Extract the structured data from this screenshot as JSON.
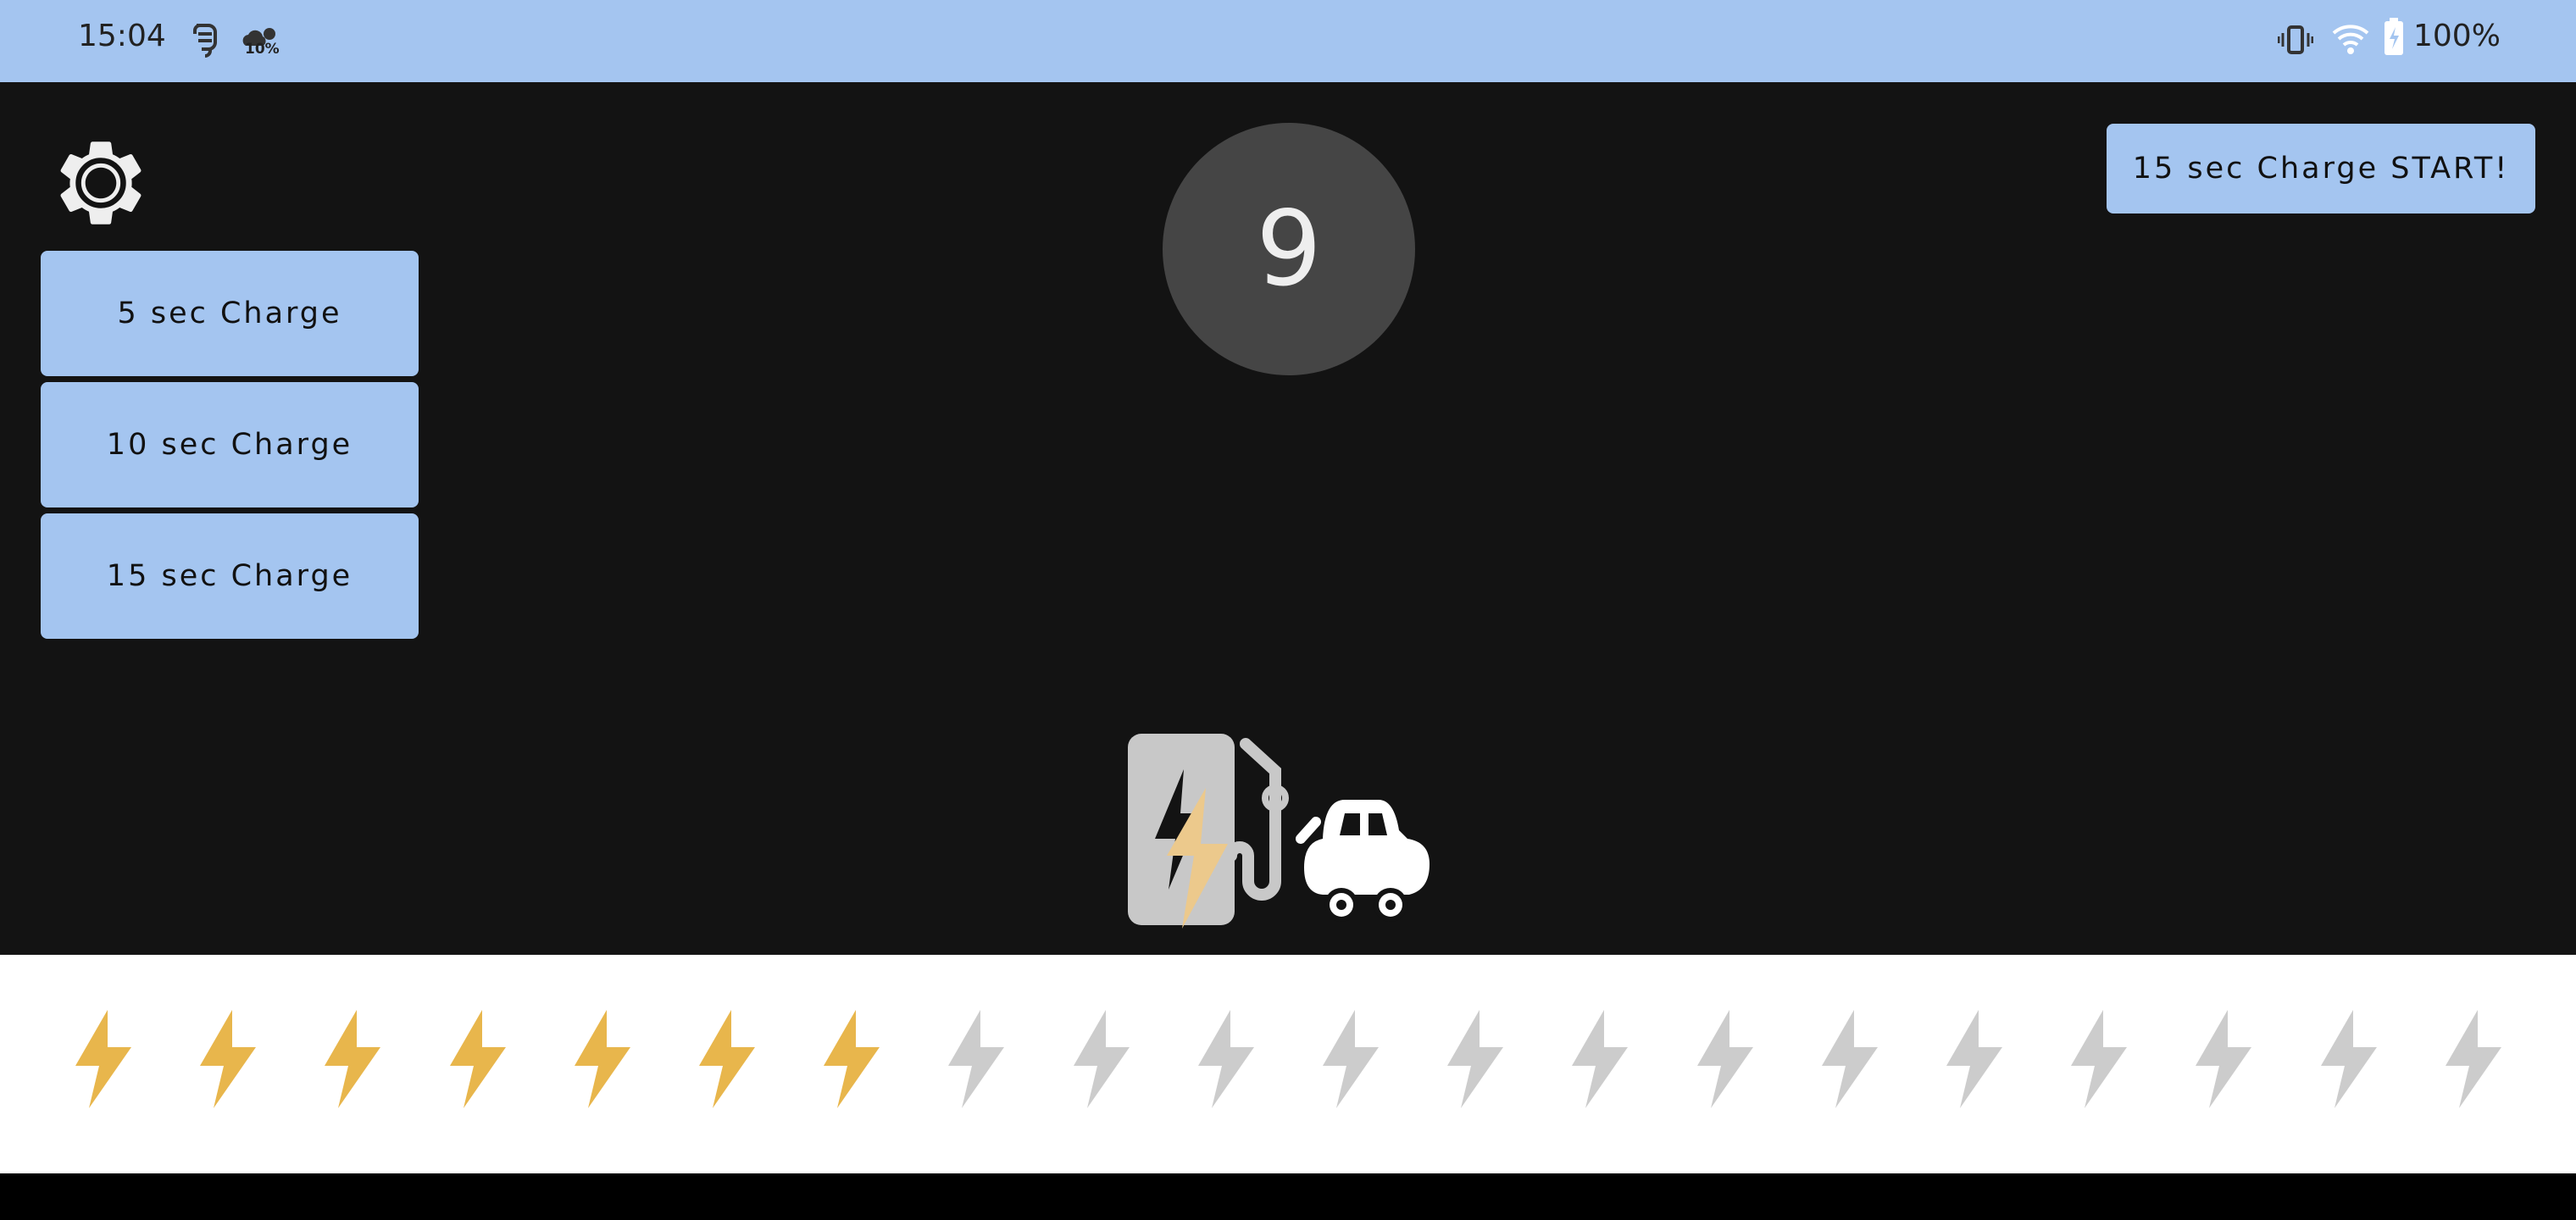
{
  "status_bar": {
    "time": "15:04",
    "weather_percent": "10%",
    "battery_percent": "100%",
    "icons": [
      "notification-icon",
      "weather-icon",
      "vibrate-icon",
      "wifi-icon",
      "battery-icon"
    ]
  },
  "settings": {
    "icon": "gear-icon"
  },
  "charge_buttons": [
    {
      "label": "5 sec Charge"
    },
    {
      "label": "10 sec Charge"
    },
    {
      "label": "15 sec Charge"
    }
  ],
  "start_button": {
    "label": "15 sec Charge START!"
  },
  "counter": {
    "value": "9"
  },
  "charge_meter": {
    "total": 20,
    "filled": 7,
    "filled_color": "#e8b64c",
    "empty_color": "#cccccc"
  },
  "colors": {
    "accent": "#a4c5f0",
    "background": "#131313",
    "counter_bg": "#454545"
  }
}
